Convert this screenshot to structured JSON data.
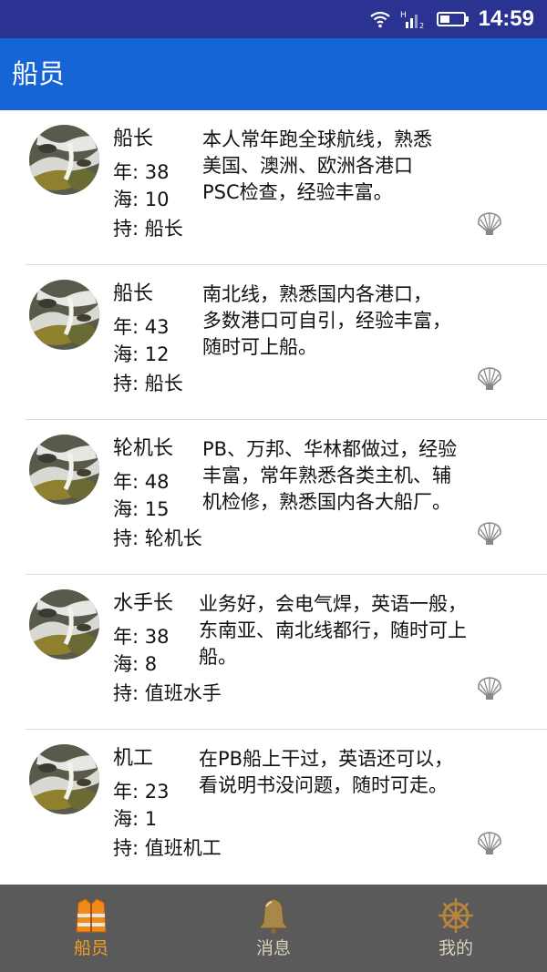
{
  "status_bar": {
    "time": "14:59",
    "signal_label": "H",
    "sim_index": "2",
    "icons": [
      "wifi-icon",
      "signal-icon",
      "battery-icon"
    ]
  },
  "app_bar": {
    "title": "船员"
  },
  "labels": {
    "age": "年:",
    "sea": "海:",
    "cert": "持:"
  },
  "crew": [
    {
      "role": "船长",
      "age": "38",
      "sea_years": "10",
      "certificate": "船长",
      "lines": [
        "本人常年跑全球航线，熟悉",
        "美国、澳洲、欧洲各港口",
        "PSC检查，经验丰富。"
      ]
    },
    {
      "role": "船长",
      "age": "43",
      "sea_years": "12",
      "certificate": "船长",
      "lines": [
        "南北线，熟悉国内各港口，",
        "多数港口可自引，经验丰富，",
        "随时可上船。"
      ]
    },
    {
      "role": "轮机长",
      "age": "48",
      "sea_years": "15",
      "certificate": "轮机长",
      "lines": [
        "PB、万邦、华林都做过，经验",
        "丰富，常年熟悉各类主机、辅",
        "机检修，熟悉国内各大船厂。"
      ]
    },
    {
      "role": "水手长",
      "age": "38",
      "sea_years": "8",
      "certificate": "值班水手",
      "lines": [
        "业务好，会电气焊，英语一般，",
        "东南亚、南北线都行，随时可上",
        "船。"
      ]
    },
    {
      "role": "机工",
      "age": "23",
      "sea_years": "1",
      "certificate": "值班机工",
      "lines": [
        "在PB船上干过，英语还可以，",
        "看说明书没问题，随时可走。"
      ]
    }
  ],
  "tabs": [
    {
      "label": "船员",
      "icon": "life-vest-icon",
      "active": true,
      "color": "#f0a020"
    },
    {
      "label": "消息",
      "icon": "bell-icon",
      "active": false,
      "color": "#d8d0b8"
    },
    {
      "label": "我的",
      "icon": "ship-wheel-icon",
      "active": false,
      "color": "#d8d0b8"
    }
  ],
  "colors": {
    "status_bar": "#2a3391",
    "app_bar": "#1565d6",
    "tab_bar": "#5a5a5a",
    "active_tab": "#f0a020"
  }
}
